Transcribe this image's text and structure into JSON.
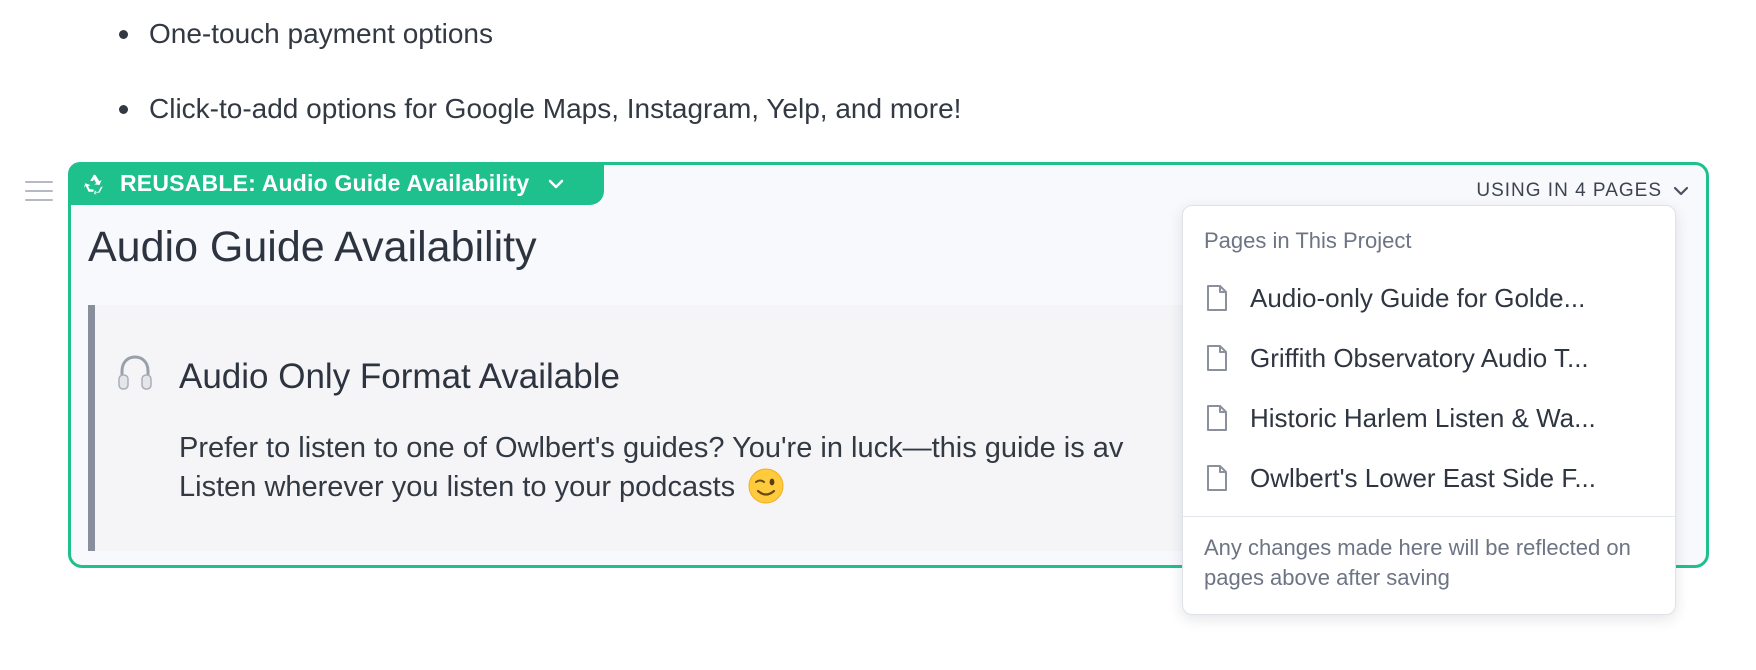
{
  "bullets": [
    "One-touch payment options",
    "Click-to-add options for Google Maps, Instagram, Yelp, and more!"
  ],
  "reusable_block": {
    "tag_label": "REUSABLE: Audio Guide Availability",
    "usage_label": "USING IN 4 PAGES",
    "title": "Audio Guide Availability",
    "accent_color": "#1ec08c",
    "callout": {
      "icon": "headphones-icon",
      "title": "Audio Only Format Available",
      "body_line1": "Prefer to listen to one of Owlbert's guides? You're in luck—this guide is av",
      "body_line2": "Listen wherever you listen to your podcasts",
      "emoji": "winking-face"
    }
  },
  "usage_dropdown": {
    "header": "Pages in This Project",
    "pages": [
      "Audio-only Guide for Golde...",
      "Griffith Observatory Audio T...",
      "Historic Harlem Listen & Wa...",
      "Owlbert's Lower East Side F..."
    ],
    "footer": "Any changes made here will be reflected on pages above after saving"
  }
}
